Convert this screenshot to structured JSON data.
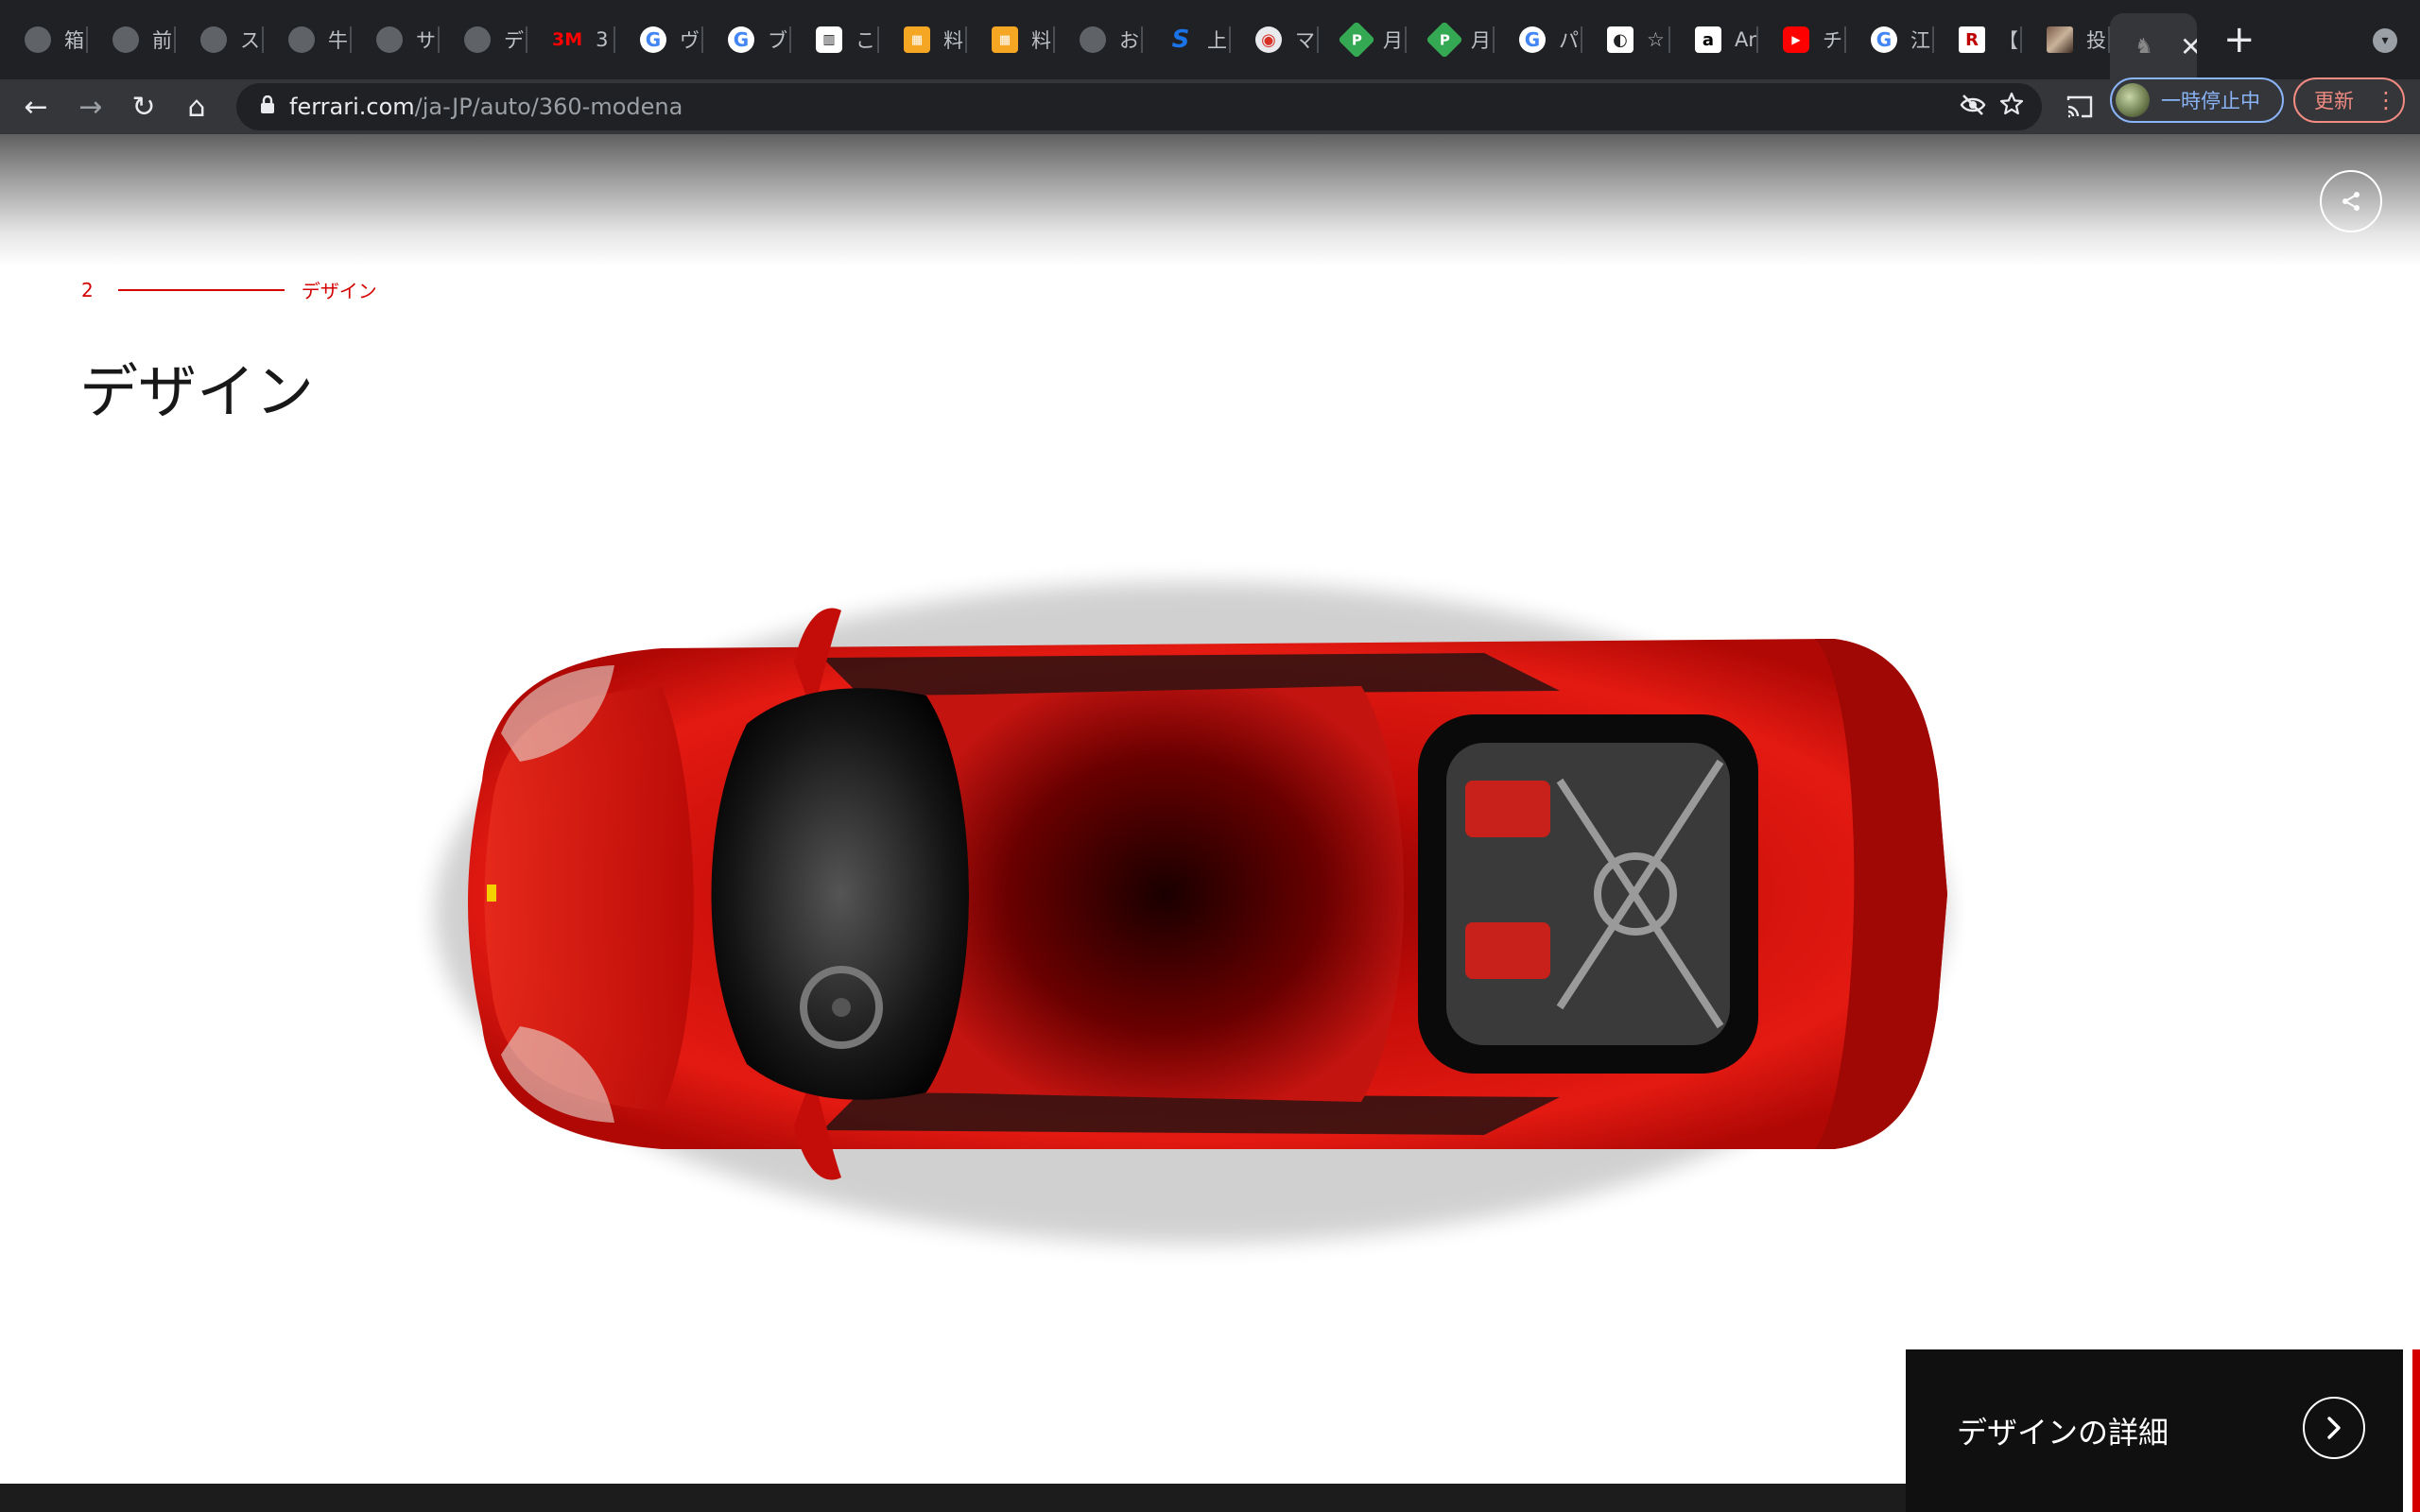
{
  "tabs": [
    {
      "icon": "globe",
      "glyph": "",
      "label": "箱"
    },
    {
      "icon": "globe",
      "glyph": "",
      "label": "前"
    },
    {
      "icon": "globe",
      "glyph": "",
      "label": "ス"
    },
    {
      "icon": "globe",
      "glyph": "",
      "label": "牛"
    },
    {
      "icon": "globe",
      "glyph": "",
      "label": "サ"
    },
    {
      "icon": "globe",
      "glyph": "",
      "label": "デ"
    },
    {
      "icon": "m3",
      "glyph": "3M",
      "label": "3"
    },
    {
      "icon": "g",
      "glyph": "G",
      "label": "ヴ"
    },
    {
      "icon": "g",
      "glyph": "G",
      "label": "ブ"
    },
    {
      "icon": "code",
      "glyph": "▥",
      "label": "こ"
    },
    {
      "icon": "food",
      "glyph": "▦",
      "label": "料"
    },
    {
      "icon": "food",
      "glyph": "▦",
      "label": "料"
    },
    {
      "icon": "globe",
      "glyph": "",
      "label": "お"
    },
    {
      "icon": "s",
      "glyph": "S",
      "label": "上"
    },
    {
      "icon": "red",
      "glyph": "◉",
      "label": "マ"
    },
    {
      "icon": "p",
      "glyph": "P",
      "label": "月"
    },
    {
      "icon": "p",
      "glyph": "P",
      "label": "月"
    },
    {
      "icon": "g",
      "glyph": "G",
      "label": "パ"
    },
    {
      "icon": "eye",
      "glyph": "◐",
      "label": "☆"
    },
    {
      "icon": "a",
      "glyph": "a",
      "label": "Ar"
    },
    {
      "icon": "yt",
      "glyph": "▶",
      "label": "チ"
    },
    {
      "icon": "g",
      "glyph": "G",
      "label": "江"
    },
    {
      "icon": "r",
      "glyph": "R",
      "label": "【"
    },
    {
      "icon": "img",
      "glyph": "",
      "label": "投"
    }
  ],
  "active_tab": {
    "glyph": "♞",
    "close": "✕"
  },
  "new_tab": "+",
  "tab_menu": "▾",
  "nav": {
    "back": "←",
    "forward": "→",
    "reload": "↻",
    "home": "⌂"
  },
  "omnibox": {
    "lock": "🔒",
    "domain": "ferrari.com",
    "path": "/ja-JP/auto/360-modena"
  },
  "profile": {
    "label": "一時停止中"
  },
  "update": {
    "label": "更新",
    "menu": "⋮"
  },
  "page": {
    "section_number": "2",
    "section_label": "デザイン",
    "title": "デザイン",
    "detail_label": "デザインの詳細",
    "detail_chevron": "›"
  },
  "colors": {
    "accent": "#d40000",
    "car_red": "#d9140e",
    "chrome_dark": "#202124",
    "chrome_toolbar": "#35363a"
  }
}
